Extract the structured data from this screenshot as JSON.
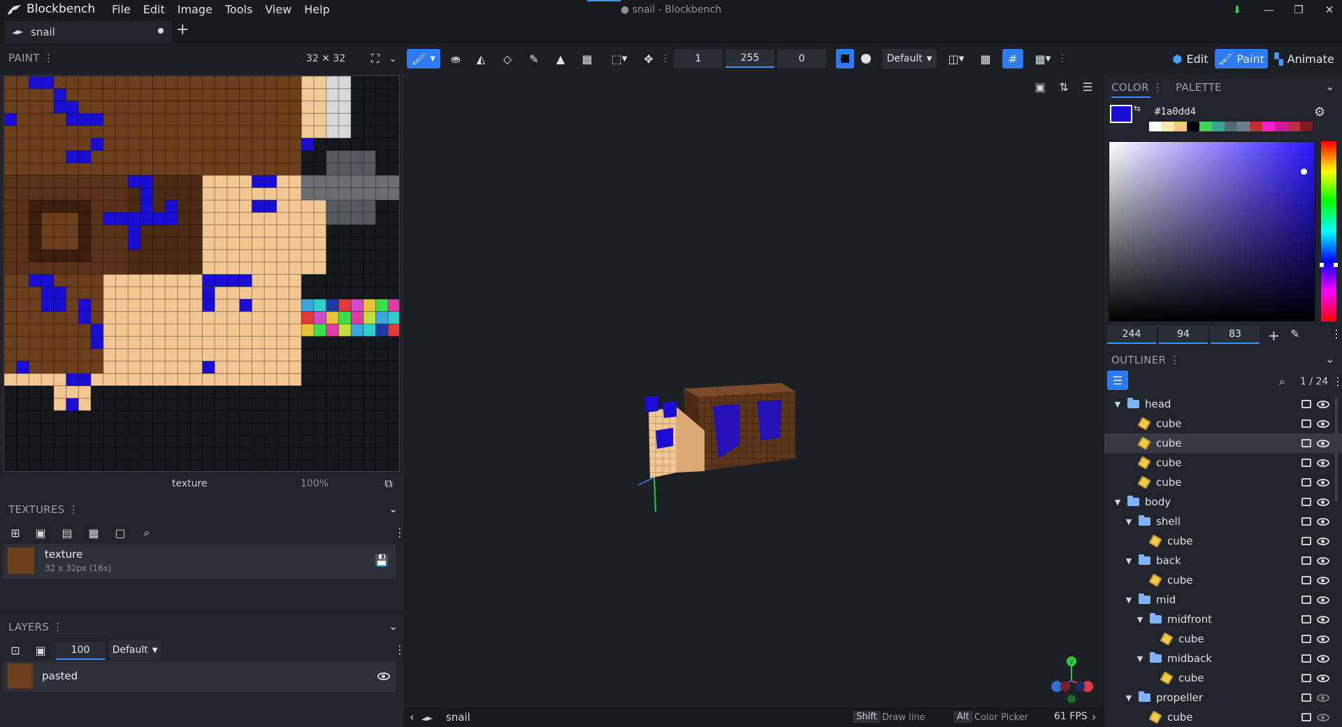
{
  "app": {
    "name": "Blockbench",
    "window_title": "● snail - Blockbench"
  },
  "menu": [
    "File",
    "Edit",
    "Image",
    "Tools",
    "View",
    "Help"
  ],
  "tabs": [
    {
      "label": "snail"
    }
  ],
  "toolbar": {
    "size_field": "1",
    "opacity_field": "255",
    "softness_field": "0",
    "blend_mode": "Default",
    "modes": {
      "edit": "Edit",
      "paint": "Paint",
      "animate": "Animate"
    }
  },
  "paint_panel": {
    "title": "PAINT",
    "resolution": "32 ✕ 32",
    "texture_name": "texture",
    "zoom": "100%"
  },
  "textures_panel": {
    "title": "TEXTURES",
    "items": [
      {
        "name": "texture",
        "meta": "32 x 32px (16x)"
      }
    ]
  },
  "layers_panel": {
    "title": "LAYERS",
    "opacity": "100",
    "blend_mode": "Default",
    "items": [
      {
        "name": "pasted"
      }
    ]
  },
  "color_panel": {
    "title": "COLOR",
    "palette_tab": "PALETTE",
    "hex": "#1a0dd4",
    "primary_color": "#1a0dd4",
    "h": "244",
    "s": "94",
    "v": "83",
    "palette": [
      "#ffffff",
      "#f5e6b0",
      "#f2c77a",
      "#000000",
      "#42d45c",
      "#3aa596",
      "#506a7a",
      "#6e7f8c",
      "#c23030",
      "#ff1fd2",
      "#d01a9a",
      "#b83046",
      "#7a1c1c"
    ]
  },
  "outliner": {
    "title": "OUTLINER",
    "count": "1 / 24",
    "rows": [
      {
        "label": "head",
        "type": "group",
        "depth": 0
      },
      {
        "label": "cube",
        "type": "cube",
        "depth": 1
      },
      {
        "label": "cube",
        "type": "cube",
        "depth": 1,
        "selected": true
      },
      {
        "label": "cube",
        "type": "cube",
        "depth": 1
      },
      {
        "label": "cube",
        "type": "cube",
        "depth": 1
      },
      {
        "label": "body",
        "type": "group",
        "depth": 0
      },
      {
        "label": "shell",
        "type": "group",
        "depth": 1
      },
      {
        "label": "cube",
        "type": "cube",
        "depth": 2
      },
      {
        "label": "back",
        "type": "group",
        "depth": 1
      },
      {
        "label": "cube",
        "type": "cube",
        "depth": 2
      },
      {
        "label": "mid",
        "type": "group",
        "depth": 1
      },
      {
        "label": "midfront",
        "type": "group",
        "depth": 2
      },
      {
        "label": "cube",
        "type": "cube",
        "depth": 3
      },
      {
        "label": "midback",
        "type": "group",
        "depth": 2
      },
      {
        "label": "cube",
        "type": "cube",
        "depth": 3
      },
      {
        "label": "propeller",
        "type": "group",
        "depth": 1,
        "hidden": true
      },
      {
        "label": "cube",
        "type": "cube",
        "depth": 2,
        "hidden": true
      }
    ]
  },
  "status_bar": {
    "model_name": "snail",
    "hint1_key": "Shift",
    "hint1_text": "Draw line",
    "hint2_key": "Alt",
    "hint2_text": "Color Picker",
    "fps": "61 FPS"
  }
}
